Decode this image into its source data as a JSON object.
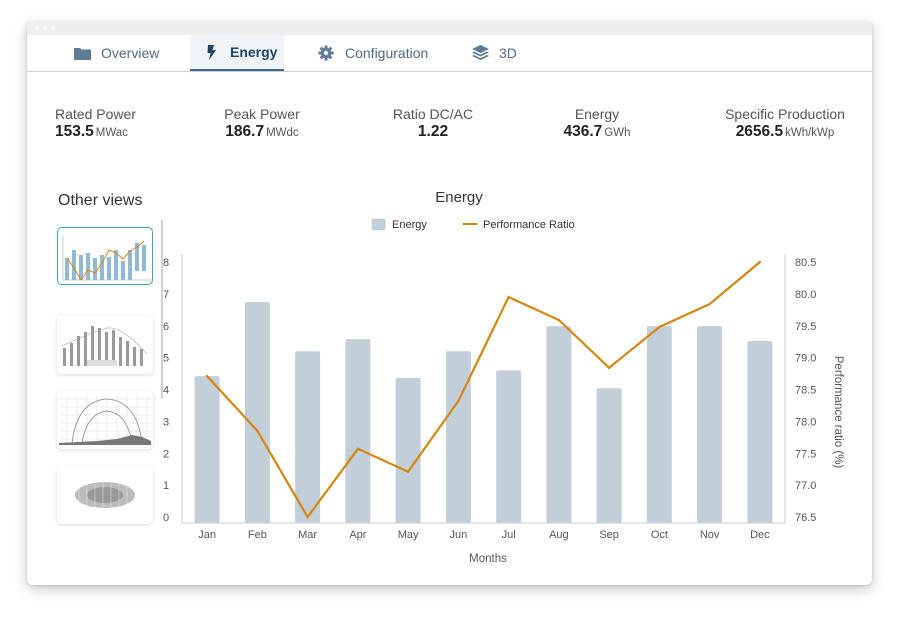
{
  "tabs": [
    {
      "label": "Overview",
      "icon": "folder-icon",
      "active": false
    },
    {
      "label": "Energy",
      "icon": "lightning-icon",
      "active": true
    },
    {
      "label": "Configuration",
      "icon": "gear-icon",
      "active": false
    },
    {
      "label": "3D",
      "icon": "layers-icon",
      "active": false
    }
  ],
  "kpis": [
    {
      "label": "Rated Power",
      "value": "153.5",
      "unit": "MWac"
    },
    {
      "label": "Peak Power",
      "value": "186.7",
      "unit": "MWdc"
    },
    {
      "label": "Ratio DC/AC",
      "value": "1.22",
      "unit": ""
    },
    {
      "label": "Energy",
      "value": "436.7",
      "unit": "GWh"
    },
    {
      "label": "Specific Production",
      "value": "2656.5",
      "unit": "kWh/kWp"
    }
  ],
  "sidebar": {
    "title": "Other views",
    "thumbnails": [
      {
        "name": "energy-performance-chart",
        "active": true
      },
      {
        "name": "monthly-irradiation-chart",
        "active": false
      },
      {
        "name": "sun-path-diagram",
        "active": false
      },
      {
        "name": "heatmap-view",
        "active": false
      }
    ]
  },
  "colors": {
    "bar": "#c2cfd8",
    "line": "#d4860f",
    "accent": "#3aa7b5",
    "tab_active": "#1f4566"
  },
  "chart_data": {
    "type": "bar",
    "title": "Energy",
    "xlabel": "Months",
    "ylabel": "",
    "y2label": "Performance ratio (%)",
    "categories": [
      "Jan",
      "Feb",
      "Mar",
      "Apr",
      "May",
      "Jun",
      "Jul",
      "Aug",
      "Sep",
      "Oct",
      "Nov",
      "Dec"
    ],
    "series": [
      {
        "name": "Energy",
        "type": "bar",
        "axis": "left",
        "values": [
          4.42,
          6.74,
          5.2,
          5.58,
          4.36,
          5.2,
          4.6,
          5.99,
          4.04,
          5.99,
          5.99,
          5.52
        ]
      },
      {
        "name": "Performance Ratio",
        "type": "line",
        "axis": "right",
        "values": [
          78.71,
          77.85,
          76.5,
          77.57,
          77.21,
          78.32,
          79.95,
          79.59,
          78.84,
          79.48,
          79.84,
          80.5
        ]
      }
    ],
    "ylim": [
      0,
      8
    ],
    "yticks": [
      0,
      1,
      2,
      3,
      4,
      5,
      6,
      7,
      8
    ],
    "y2lim": [
      76.5,
      80.5
    ],
    "y2ticks": [
      "76.5",
      "77.0",
      "77.5",
      "78.0",
      "78.5",
      "79.0",
      "79.5",
      "80.0",
      "80.5"
    ],
    "legend": {
      "position": "top-center",
      "entries": [
        "Energy",
        "Performance Ratio"
      ]
    },
    "grid": false
  }
}
